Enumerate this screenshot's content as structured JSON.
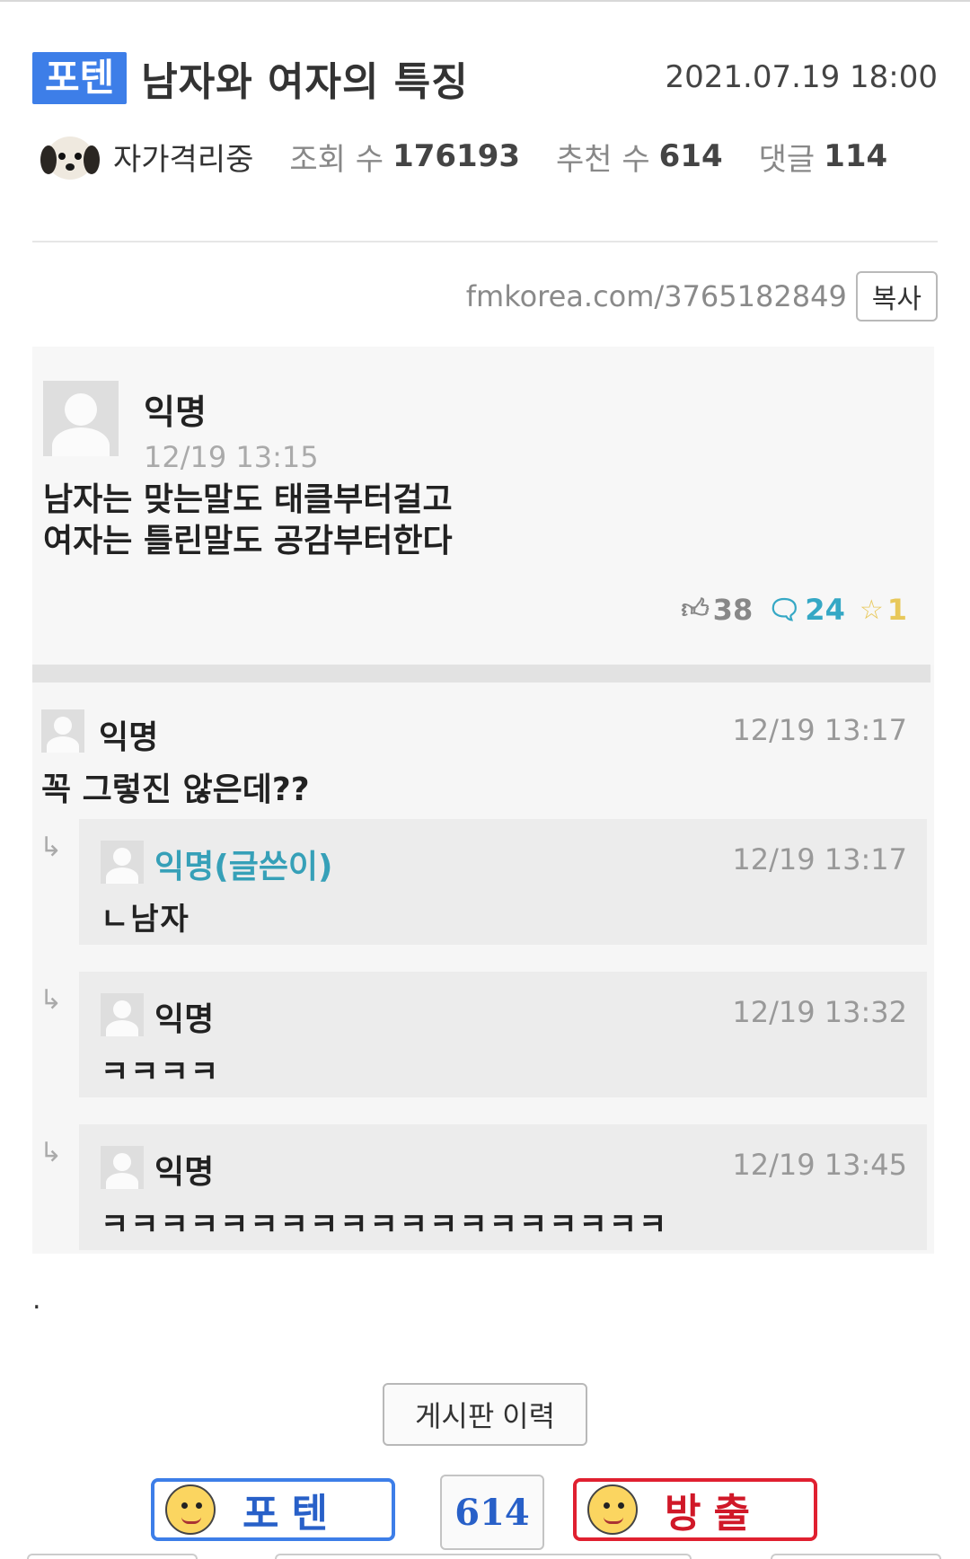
{
  "header": {
    "category_badge": "포텐",
    "title": "남자와 여자의 특징",
    "date": "2021.07.19 18:00",
    "author": "자가격리중",
    "views_label": "조회 수",
    "views": "176193",
    "recommend_label": "추천 수",
    "recommend": "614",
    "comments_label": "댓글",
    "comments": "114"
  },
  "share": {
    "url": "fmkorea.com/3765182849",
    "copy_label": "복사"
  },
  "captured_post": {
    "author": "익명",
    "time": "12/19 13:15",
    "body_line1": "남자는 맞는말도 태클부터걸고",
    "body_line2": "여자는 틀린말도 공감부터한다",
    "likes": "38",
    "comments": "24",
    "scraps": "1",
    "accent_comment_color": "#35a8c5"
  },
  "captured_comment": {
    "author": "익명",
    "time": "12/19 13:17",
    "body": "꼭 그렇진 않은데??"
  },
  "captured_replies": [
    {
      "author": "익명(글쓴이)",
      "time": "12/19 13:17",
      "body": "ㄴ남자"
    },
    {
      "author": "익명",
      "time": "12/19 13:32",
      "body": "ㅋㅋㅋㅋ"
    },
    {
      "author": "익명",
      "time": "12/19 13:45",
      "body": "ㅋㅋㅋㅋㅋㅋㅋㅋㅋㅋㅋㅋㅋㅋㅋㅋㅋㅋㅋ"
    }
  ],
  "footer": {
    "dot": ".",
    "history_button": "게시판 이력",
    "vote_up_label": "포텐",
    "vote_count": "614",
    "vote_down_label": "방출",
    "vote_up_color": "#3d7ee8",
    "vote_down_color": "#e02030"
  }
}
